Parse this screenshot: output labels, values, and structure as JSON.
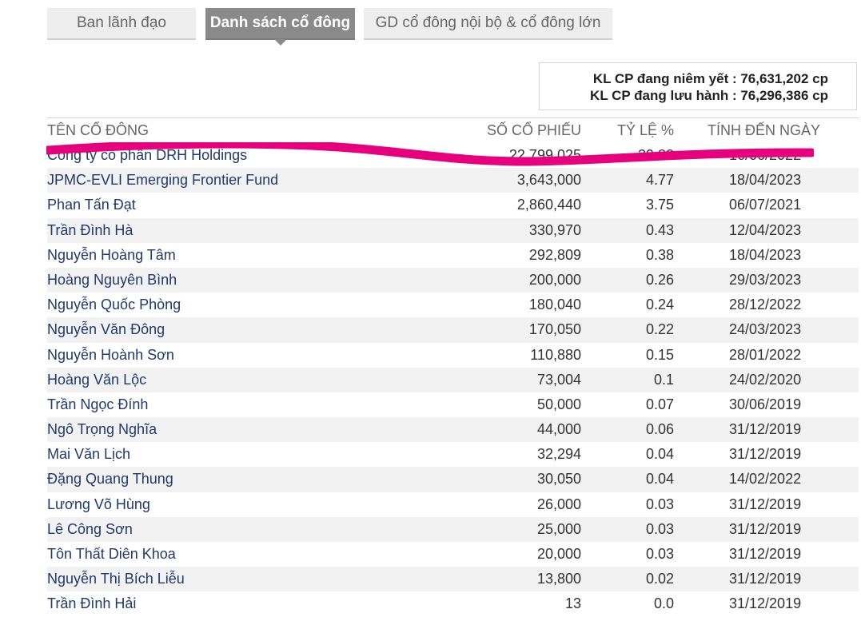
{
  "tabs": [
    {
      "label": "Ban lãnh đạo",
      "active": false
    },
    {
      "label": "Danh sách cổ đông",
      "active": true
    },
    {
      "label": "GD cổ đông nội bộ & cổ đông lớn",
      "active": false
    }
  ],
  "summary": {
    "listed": "KL CP đang niêm yết : 76,631,202 cp",
    "outstanding": "KL CP đang lưu hành : 76,296,386 cp"
  },
  "table": {
    "headers": {
      "name": "TÊN CỔ ĐÔNG",
      "shares": "SỐ CỔ PHIẾU",
      "ratio": "TỶ LỆ %",
      "date": "TÍNH ĐẾN NGÀY"
    },
    "rows": [
      {
        "name": "Công ty cổ phần DRH Holdings",
        "shares": "22,799,025",
        "ratio": "29.88",
        "date": "16/06/2022"
      },
      {
        "name": "JPMC-EVLI Emerging Frontier Fund",
        "shares": "3,643,000",
        "ratio": "4.77",
        "date": "18/04/2023"
      },
      {
        "name": "Phan Tấn Đạt",
        "shares": "2,860,440",
        "ratio": "3.75",
        "date": "06/07/2021"
      },
      {
        "name": "Trần Đình Hà",
        "shares": "330,970",
        "ratio": "0.43",
        "date": "12/04/2023"
      },
      {
        "name": "Nguyễn Hoàng Tâm",
        "shares": "292,809",
        "ratio": "0.38",
        "date": "18/04/2023"
      },
      {
        "name": "Hoàng Nguyên Bình",
        "shares": "200,000",
        "ratio": "0.26",
        "date": "29/03/2023"
      },
      {
        "name": "Nguyễn Quốc Phòng",
        "shares": "180,040",
        "ratio": "0.24",
        "date": "28/12/2022"
      },
      {
        "name": "Nguyễn Văn Đông",
        "shares": "170,050",
        "ratio": "0.22",
        "date": "24/03/2023"
      },
      {
        "name": "Nguyễn Hoành Sơn",
        "shares": "110,880",
        "ratio": "0.15",
        "date": "28/01/2022"
      },
      {
        "name": "Hoàng Văn Lộc",
        "shares": "73,004",
        "ratio": "0.1",
        "date": "24/02/2020"
      },
      {
        "name": "Trần Ngọc Đính",
        "shares": "50,000",
        "ratio": "0.07",
        "date": "30/06/2019"
      },
      {
        "name": "Ngô Trọng Nghĩa",
        "shares": "44,000",
        "ratio": "0.06",
        "date": "31/12/2019"
      },
      {
        "name": "Mai Văn Lịch",
        "shares": "32,294",
        "ratio": "0.04",
        "date": "31/12/2019"
      },
      {
        "name": "Đặng Quang Thung",
        "shares": "30,050",
        "ratio": "0.04",
        "date": "14/02/2022"
      },
      {
        "name": "Lương Võ Hùng",
        "shares": "26,000",
        "ratio": "0.03",
        "date": "31/12/2019"
      },
      {
        "name": "Lê Công Sơn",
        "shares": "25,000",
        "ratio": "0.03",
        "date": "31/12/2019"
      },
      {
        "name": "Tôn Thất Diên Khoa",
        "shares": "20,000",
        "ratio": "0.03",
        "date": "31/12/2019"
      },
      {
        "name": "Nguyễn Thị Bích Liễu",
        "shares": "13,800",
        "ratio": "0.02",
        "date": "31/12/2019"
      },
      {
        "name": "Trần Đình Hải",
        "shares": "13",
        "ratio": "0.0",
        "date": "31/12/2019"
      }
    ]
  },
  "annotation": {
    "color": "#e6007e"
  }
}
